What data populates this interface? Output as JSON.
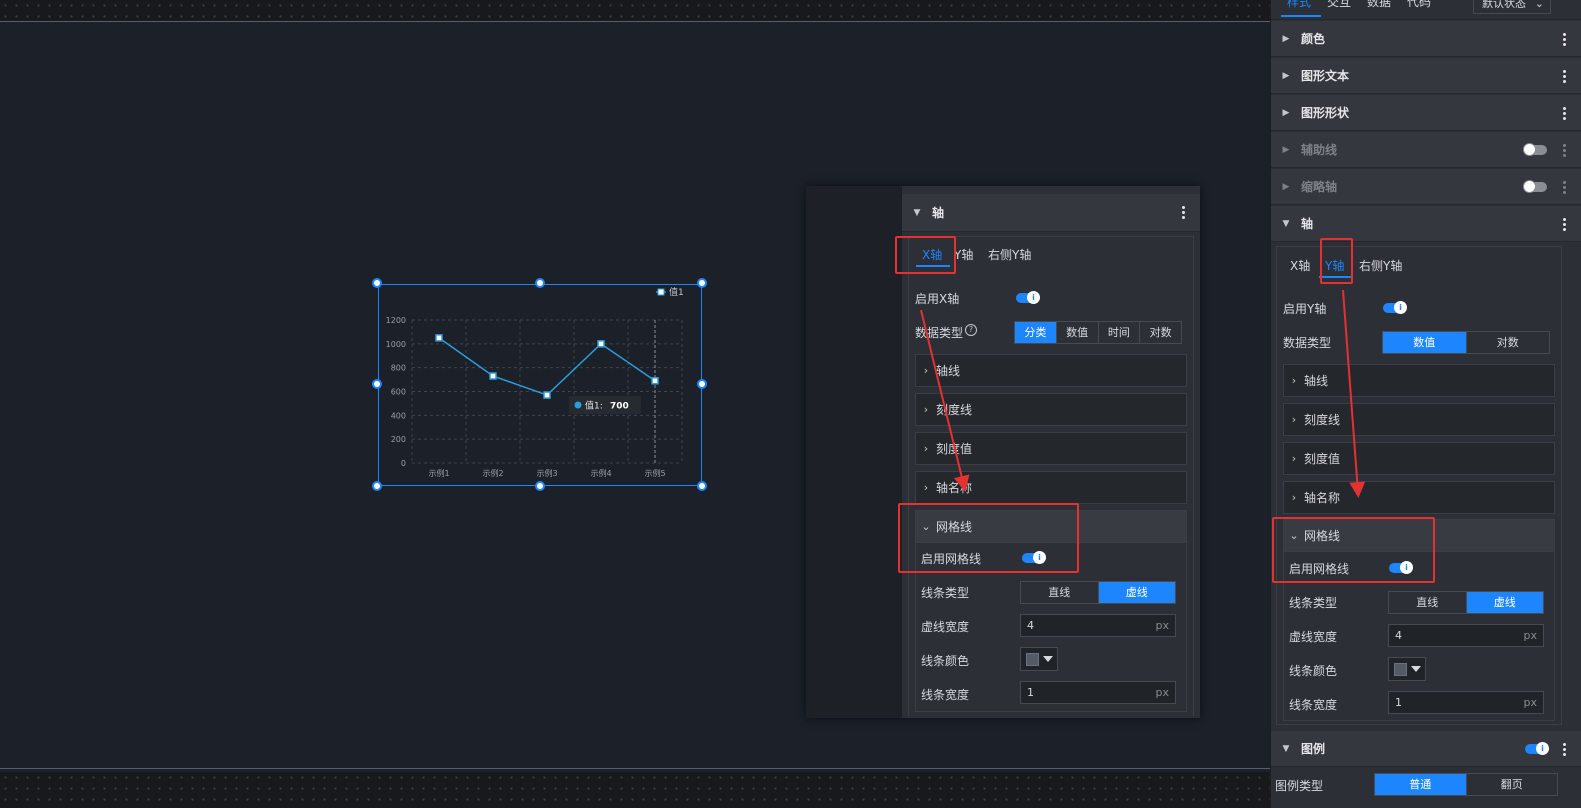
{
  "chart_data": {
    "type": "line",
    "categories": [
      "示例1",
      "示例2",
      "示例3",
      "示例4",
      "示例5"
    ],
    "series": [
      {
        "name": "值1",
        "values": [
          1050,
          730,
          570,
          1000,
          690
        ]
      }
    ],
    "ylim": [
      0,
      1200
    ],
    "yticks": [
      "0",
      "200",
      "400",
      "600",
      "800",
      "1000",
      "1200"
    ],
    "grid": true,
    "legend": "top-right",
    "tooltip": {
      "label": "值1:",
      "value": "700"
    },
    "color": "#2d9cdb"
  },
  "right_panel": {
    "top_tabs": [
      "样式",
      "交互",
      "数据",
      "代码"
    ],
    "state_dropdown": "默认状态",
    "sections": {
      "color": "颜色",
      "shape_text": "图形文本",
      "shape_form": "图形形状",
      "aux_line": "辅助线",
      "zoom_axis": "缩略轴",
      "axis": "轴",
      "legend": "图例"
    },
    "axis_tabs": [
      "X轴",
      "Y轴",
      "右侧Y轴"
    ],
    "enable_y": "启用Y轴",
    "data_type_label": "数据类型",
    "data_types": [
      "数值",
      "对数"
    ],
    "collapses": [
      "轴线",
      "刻度线",
      "刻度值",
      "轴名称"
    ],
    "grid_title": "网格线",
    "enable_grid": "启用网格线",
    "line_type_label": "线条类型",
    "line_types": [
      "直线",
      "虚线"
    ],
    "dash_width_label": "虚线宽度",
    "dash_width": "4",
    "unit": "px",
    "line_color_label": "线条颜色",
    "line_width_label": "线条宽度",
    "line_width": "1",
    "legend_type_label": "图例类型",
    "legend_types": [
      "普通",
      "翻页"
    ]
  },
  "mid_panel": {
    "section_title": "轴",
    "axis_tabs": [
      "X轴",
      "Y轴",
      "右侧Y轴"
    ],
    "enable_x": "启用X轴",
    "data_type_label": "数据类型",
    "help_glyph": "?",
    "data_types": [
      "分类",
      "数值",
      "时间",
      "对数"
    ],
    "collapses": [
      "轴线",
      "刻度线",
      "刻度值",
      "轴名称"
    ],
    "grid_title": "网格线",
    "enable_grid": "启用网格线",
    "line_type_label": "线条类型",
    "line_types": [
      "直线",
      "虚线"
    ],
    "dash_width_label": "虚线宽度",
    "dash_width": "4",
    "unit": "px",
    "line_color_label": "线条颜色",
    "line_width_label": "线条宽度",
    "line_width": "1"
  }
}
